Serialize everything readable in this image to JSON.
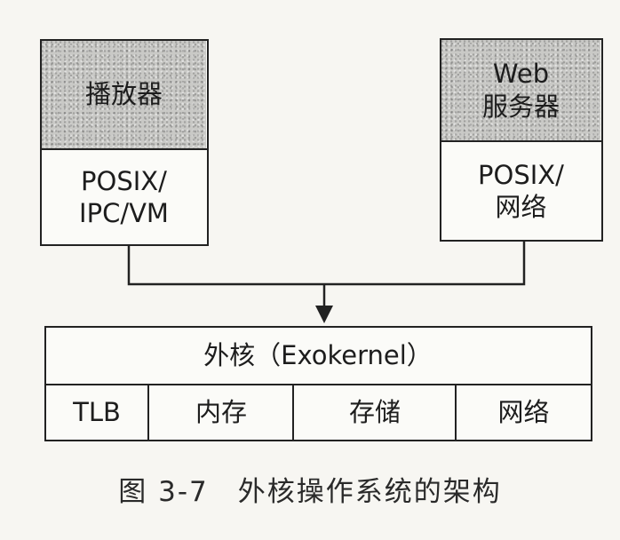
{
  "left_app": {
    "name": "播放器",
    "libos_line1": "POSIX/",
    "libos_line2": "IPC/VM"
  },
  "right_app": {
    "name_line1": "Web",
    "name_line2": "服务器",
    "libos_line1": "POSIX/",
    "libos_line2": "网络"
  },
  "exokernel": {
    "title": "外核（Exokernel）",
    "components": [
      "TLB",
      "内存",
      "存储",
      "网络"
    ]
  },
  "caption": "图 3-7　外核操作系统的架构"
}
